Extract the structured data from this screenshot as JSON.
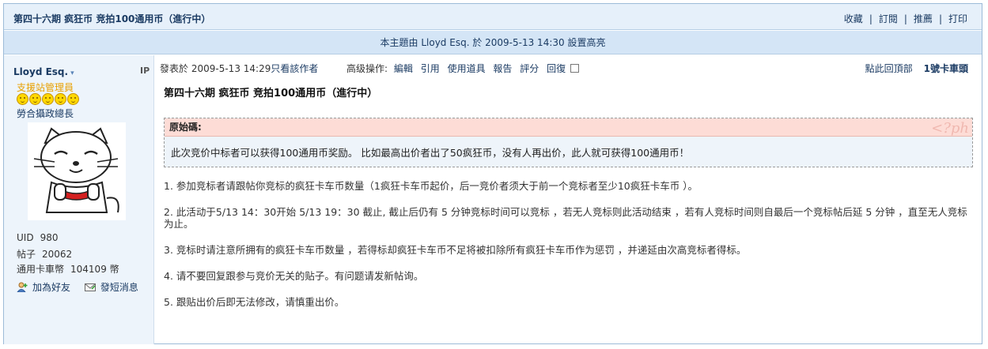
{
  "thread": {
    "title": "第四十六期  疯狂币  竞拍100通用币（進行中）",
    "actions": [
      "收藏",
      "訂閱",
      "推薦",
      "打印"
    ],
    "separator": "|",
    "notice": "本主題由  Lloyd Esq. 於  2009-5-13 14:30 設置高亮"
  },
  "author": {
    "name": "Lloyd Esq.",
    "ip_label": "IP",
    "rank": "支援站管理員",
    "stars": 5,
    "group": "勞合攝政總長",
    "stats": [
      {
        "label": "UID",
        "value": "980"
      },
      {
        "label": "帖子",
        "value": "20062"
      },
      {
        "label": "通用卡車幣",
        "value": "104109 幣"
      }
    ],
    "add_friend": "加為好友",
    "send_message": "發短消息"
  },
  "postinfo": {
    "posted_label": "發表於",
    "posted_time": "2009-5-13 14:29",
    "only_author": "只看該作者",
    "advanced_label": "高级操作:",
    "ops": [
      "編輯",
      "引用",
      "使用道具",
      "報告",
      "評分",
      "回復"
    ],
    "back_top": "點此回頂部",
    "floor": "1號卡車頭"
  },
  "post": {
    "title": "第四十六期  疯狂币  竞拍100通用币（進行中）",
    "quote_label": "原始碼:",
    "quote_tag": "<?ph",
    "quote_text": "此次竞价中标者可以获得100通用币奖励。 比如最高出价者出了50疯狂币，没有人再出价，此人就可获得100通用币！",
    "rules": [
      "1. 参加竞标者请跟帖你竞标的疯狂卡车币数量（1疯狂卡车币起价，后一竞价者须大于前一个竞标者至少10疯狂卡车币 ）。",
      "2. 此活动于5/13 14：30开始  5/13 19：30 截止, 截止后仍有  5 分钟竞标时间可以竞标 ，若无人竞标则此活动结束 ，若有人竞标时间则自最后一个竞标帖后延  5 分钟 ，直至无人竞标为止。",
      "3. 竞标时请注意所拥有的疯狂卡车币数量 ，若得标却疯狂卡车币不足将被扣除所有疯狂卡车币作为惩罚 ，并递延由次高竞标者得标。",
      "4. 请不要回复跟参与竞价无关的贴子。有问题请发新帖询。",
      "5. 跟贴出价后即无法修改，请慎重出价。"
    ]
  },
  "colors": {
    "title_bar": "#e6f0fa",
    "notice_bar": "#d4e5f6",
    "sidebar": "#edf4fb",
    "rank": "#e8a000",
    "quote_head": "#fddcd6",
    "link": "#1b3b63"
  },
  "icons": [
    "chevron-down-icon",
    "star-icon",
    "avatar-cat-image",
    "add-friend-icon",
    "message-icon",
    "checkbox-icon"
  ]
}
